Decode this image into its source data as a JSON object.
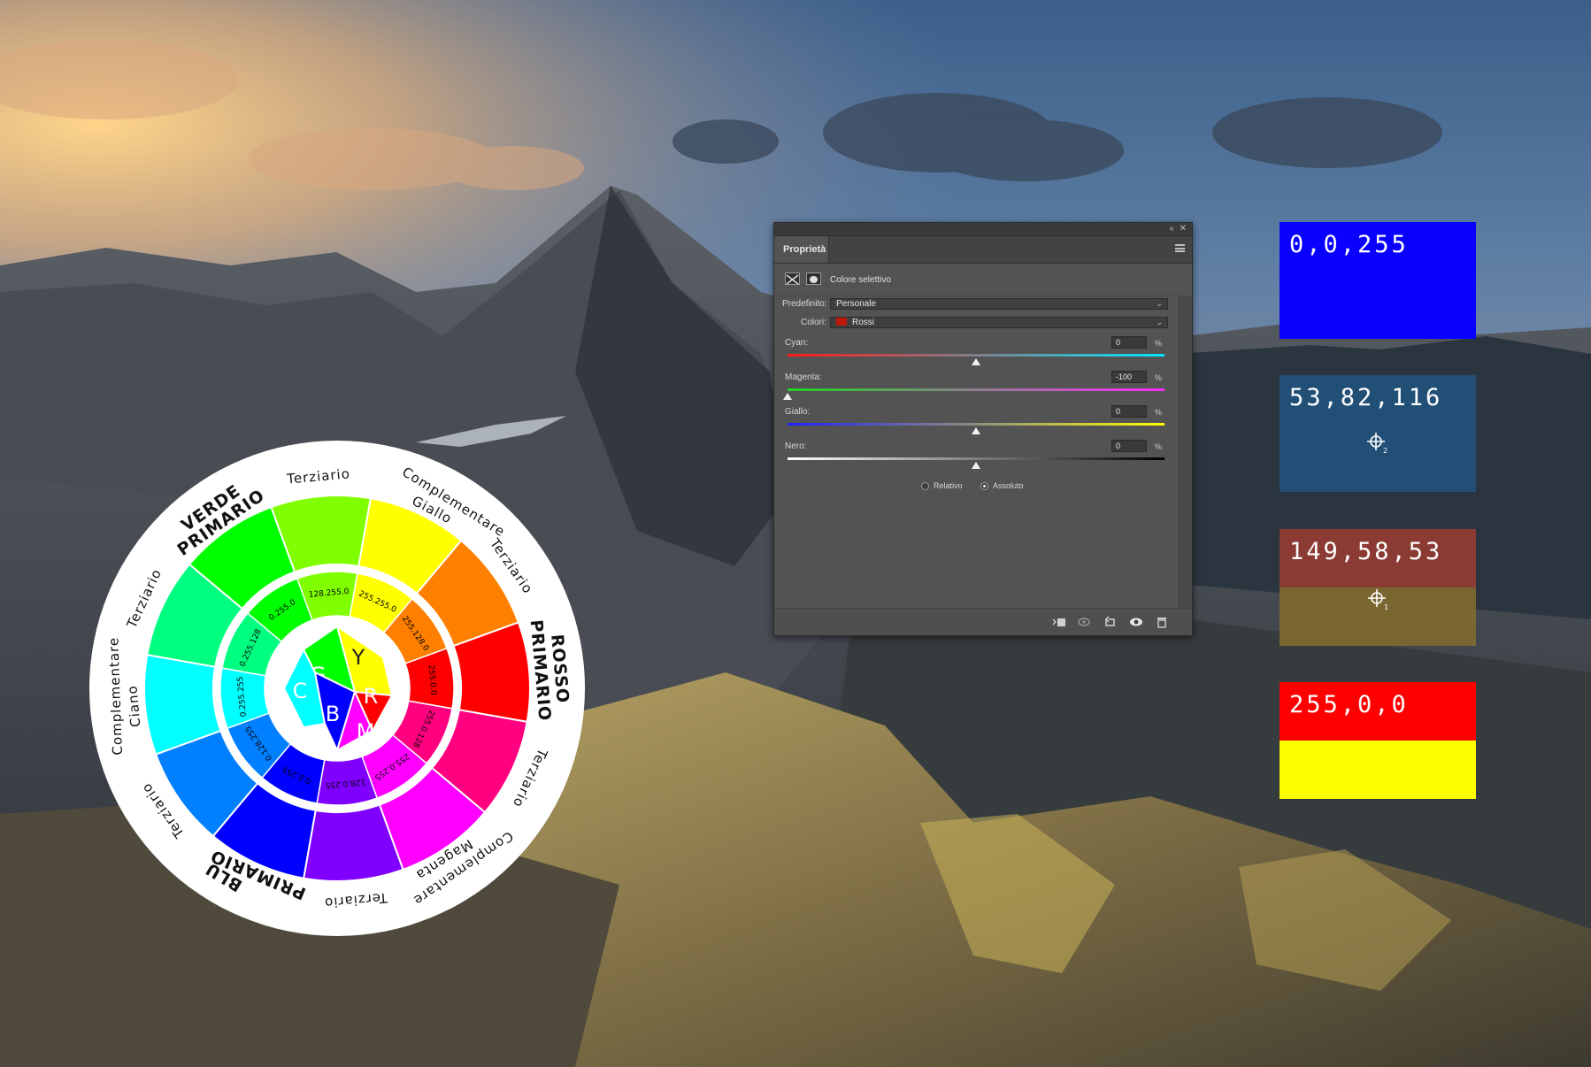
{
  "panel": {
    "tab": "Proprietà",
    "adjustment_title": "Colore selettivo",
    "preset_label": "Predefinito:",
    "preset_value": "Personale",
    "colors_label": "Colori:",
    "colors_value": "Rossi",
    "sliders": [
      {
        "label": "Cyan:",
        "value": "0",
        "unit": "%",
        "position": 0.5
      },
      {
        "label": "Magenta:",
        "value": "-100",
        "unit": "%",
        "position": 0.0
      },
      {
        "label": "Giallo:",
        "value": "0",
        "unit": "%",
        "position": 0.5
      },
      {
        "label": "Nero:",
        "value": "0",
        "unit": "%",
        "position": 0.5
      }
    ],
    "method_options": [
      "Relativo",
      "Assoluto"
    ],
    "method_selected": "Assoluto"
  },
  "wheel": {
    "outer_labels": {
      "verde": "VERDE",
      "verde_primario": "PRIMARIO",
      "terziario_top": "Terziario",
      "compl_giallo_1": "Complementare",
      "compl_giallo_2": "Giallo",
      "terziario_right_top": "Terziario",
      "rosso": "ROSSO",
      "rosso_primario": "PRIMARIO",
      "terziario_right_bottom": "Terziario",
      "compl_magenta_1": "Complementare",
      "compl_magenta_2": "Magenta",
      "terziario_bottom": "Terziario",
      "blu": "BLU",
      "blu_primario": "PRIMARIO",
      "terziario_left_bottom": "Terziario",
      "compl_ciano_1": "Complementare",
      "compl_ciano_2": "Ciano",
      "terziario_left_top": "Terziario"
    },
    "inner_values": [
      "0.255.0",
      "128.255.0",
      "255.255.0",
      "255.128.0",
      "255.0.0",
      "255.0.128",
      "255.0.255",
      "128.0.255",
      "0.0.255",
      "0.128.255",
      "0.255.255",
      "0.255.128"
    ],
    "center_letters": {
      "g": "G",
      "y": "Y",
      "c": "C",
      "r": "R",
      "b": "B",
      "m": "M"
    },
    "colors": {
      "primary_green": "#00ff00",
      "yellow": "#ffff00",
      "red": "#ff0000",
      "blue": "#0000ff",
      "cyan": "#00ffff",
      "magenta": "#ff00ff"
    }
  },
  "cards": [
    {
      "label": "0,0,255",
      "top_color": "#0a00ff",
      "bottom_color": "#0a00ff"
    },
    {
      "label": "53,82,116",
      "top_color": "#214f76",
      "bottom_color": "#214f76",
      "marker": "2"
    },
    {
      "label": "149,58,53",
      "top_color": "#8b3a34",
      "bottom_color": "#7a6631",
      "marker": "1"
    },
    {
      "label": "255,0,0",
      "top_color": "#ff0000",
      "bottom_color": "#ffff00"
    }
  ]
}
